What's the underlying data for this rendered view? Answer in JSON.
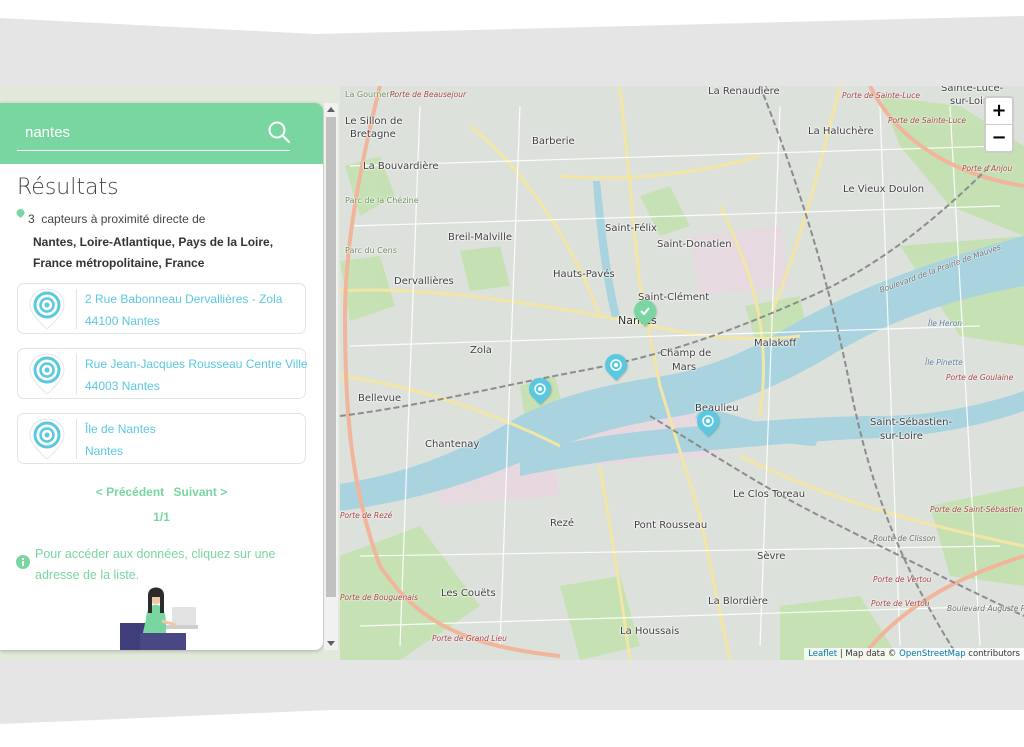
{
  "search": {
    "value": "nantes",
    "placeholder": ""
  },
  "results": {
    "title": "Résultats",
    "count": "3",
    "count_suffix": "capteurs à proximité directe de",
    "place_line1": "Nantes, Loire-Atlantique, Pays de la Loire,",
    "place_line2": "France métropolitaine, France"
  },
  "cards": [
    {
      "line1": "2 Rue Babonneau Dervallières - Zola",
      "line2": "44100 Nantes"
    },
    {
      "line1": "Rue Jean-Jacques Rousseau Centre Ville",
      "line2": "44003 Nantes"
    },
    {
      "line1": "Île de Nantes",
      "line2": "Nantes"
    }
  ],
  "pager": {
    "prev": "< Précédent",
    "next": "Suivant >",
    "pages": "1/1"
  },
  "info": {
    "line1": "Pour accéder aux données, cliquez sur une",
    "line2": "adresse de la liste."
  },
  "map": {
    "zoom_in": "+",
    "zoom_out": "−",
    "attribution": {
      "leaflet": "Leaflet",
      "sep": " | Map data © ",
      "osm": "OpenStreetMap",
      "suffix": " contributors"
    },
    "places": {
      "renaudiere": "La Renaudière",
      "sainte_luce_1": "Sainte-Luce-",
      "sainte_luce_2": "sur-Loire",
      "sillon_1": "Le Sillon de",
      "sillon_2": "Bretagne",
      "barberie": "Barberie",
      "haluchere": "La Haluchère",
      "bouvardiere": "La Bouvardière",
      "vieux_doulon": "Le Vieux Doulon",
      "saint_felix": "Saint-Félix",
      "breil": "Breil-Malville",
      "saint_donatien": "Saint-Donatien",
      "hauts_paves": "Hauts-Pavés",
      "dervallieres": "Dervallières",
      "saint_clement": "Saint-Clément",
      "nantes": "Nantes",
      "zola": "Zola",
      "champ_1": "Champ de",
      "champ_2": "Mars",
      "malakoff": "Malakoff",
      "ile_heron": "Île Heron",
      "ile_pinette": "Île Pinette",
      "bellevue": "Bellevue",
      "beaulieu": "Beaulieu",
      "chantenay": "Chantenay",
      "sebastien_1": "Saint-Sébastien-",
      "sebastien_2": "sur-Loire",
      "clos_toreau": "Le Clos Toreau",
      "reze": "Rezé",
      "pont_rousseau": "Pont Rousseau",
      "sevre": "Sèvre",
      "couets": "Les Couëts",
      "blordiere": "La Blordière",
      "houssais": "La Houssais",
      "gournerie": "La Gournerie",
      "chezine": "Parc de la Chézine",
      "parc_cens": "Parc du Cens"
    },
    "roads": {
      "porte_beausejour": "Porte de Beausejour",
      "porte_ste_luce_1": "Porte de Sainte-Luce",
      "porte_ste_luce_2": "Porte de Sainte-Luce",
      "porte_anjou": "Porte d'Anjou",
      "bd_mauves": "Boulevard de la Prairie de Mauves",
      "porte_goulaine": "Porte de Goulaine",
      "porte_st_seb": "Porte de Saint-Sébastien",
      "route_clisson": "Route de Clisson",
      "porte_vertou_1": "Porte de Vertou",
      "porte_vertou_2": "Porte de Vertou",
      "bd_auguste": "Boulevard Auguste Pé",
      "porte_bouguenais": "Porte de Bouguenais",
      "porte_grand_lieu": "Porte de Grand Lieu",
      "porte_reze": "Porte de Rezé"
    }
  }
}
